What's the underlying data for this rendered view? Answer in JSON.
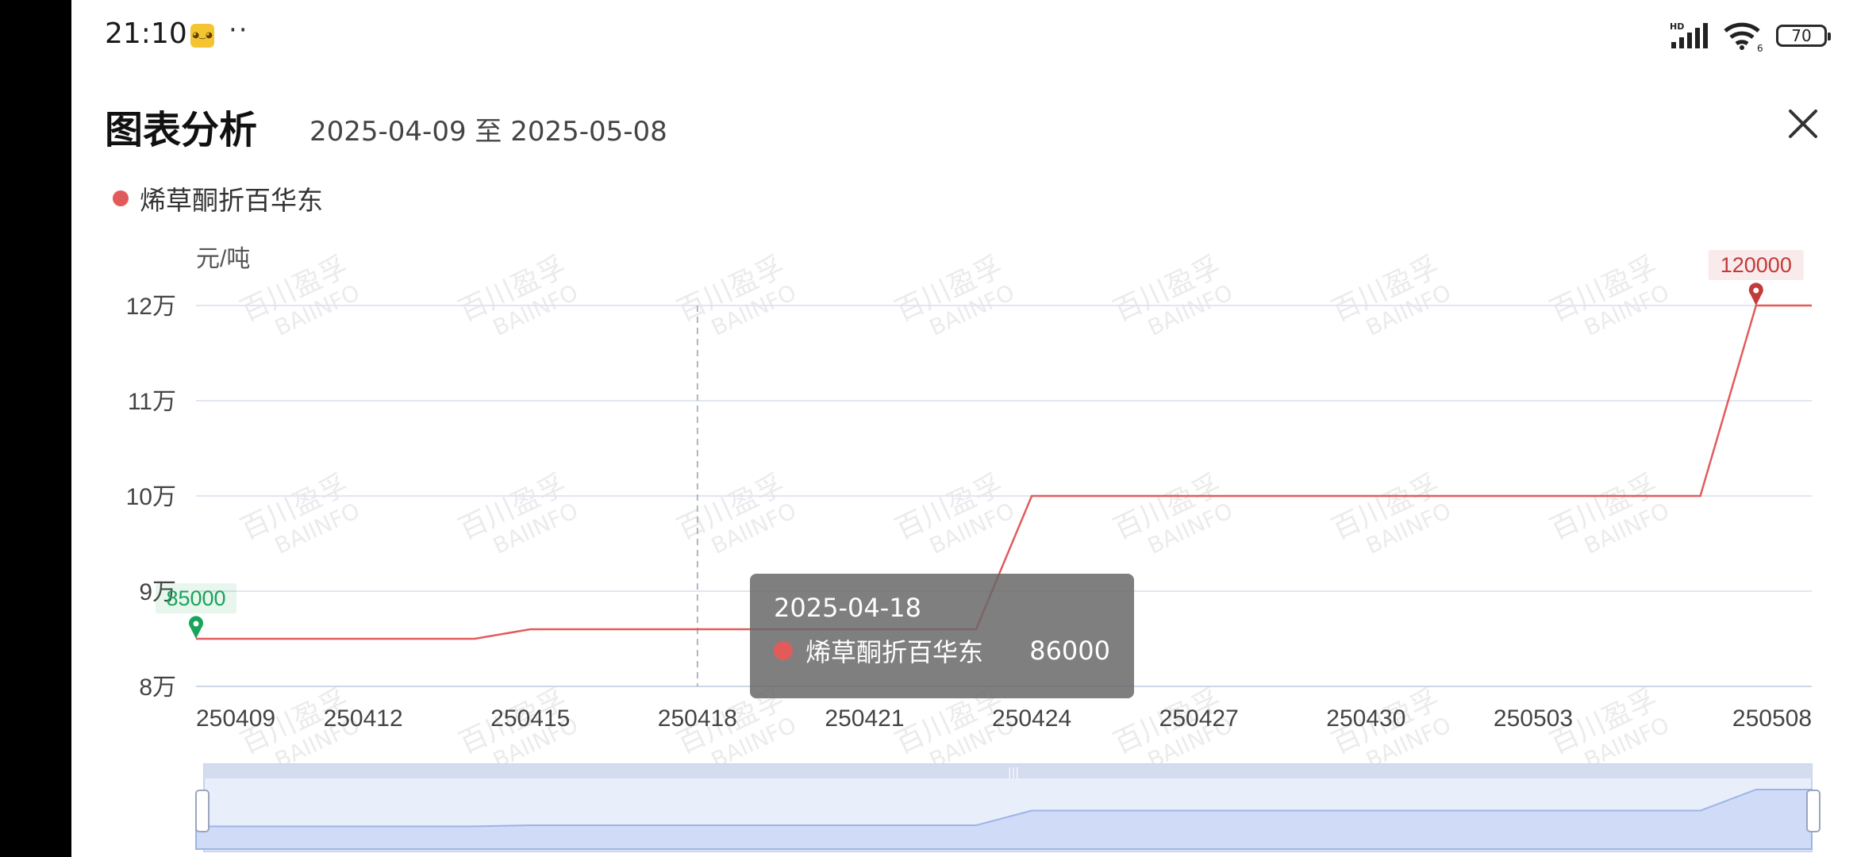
{
  "status_bar": {
    "time": "21:10",
    "dots": "··",
    "network_label": "HD",
    "wifi_label": "6",
    "battery": "70"
  },
  "header": {
    "title": "图表分析",
    "date_range": "2025-04-09 至 2025-05-08",
    "close_icon": "close-icon"
  },
  "legend": {
    "label": "烯草酮折百华东",
    "color": "#e25b5b"
  },
  "tooltip": {
    "date": "2025-04-18",
    "series": "烯草酮折百华东",
    "value": "86000"
  },
  "watermark": {
    "line1": "百川盈孚",
    "line2": "BAIINFO"
  },
  "chart_data": {
    "type": "line",
    "unit_label": "元/吨",
    "y_ticks": [
      "12万",
      "11万",
      "10万",
      "9万",
      "8万"
    ],
    "x_tick_labels": [
      "250409",
      "250412",
      "250415",
      "250418",
      "250421",
      "250424",
      "250427",
      "250430",
      "250503",
      "250508"
    ],
    "ylim": [
      80000,
      120000
    ],
    "x": [
      "2025-04-09",
      "2025-04-14",
      "2025-04-15",
      "2025-04-23",
      "2025-04-24",
      "2025-05-06",
      "2025-05-07",
      "2025-05-08"
    ],
    "series": [
      {
        "name": "烯草酮折百华东",
        "color": "#e25b5b",
        "values": [
          85000,
          85000,
          86000,
          86000,
          100000,
          100000,
          120000,
          120000
        ]
      }
    ],
    "min_marker": {
      "label": "85000",
      "color": "#1aa35a"
    },
    "max_marker": {
      "label": "120000",
      "color": "#c23a3a"
    },
    "crosshair_date": "2025-04-18",
    "grid": true
  }
}
